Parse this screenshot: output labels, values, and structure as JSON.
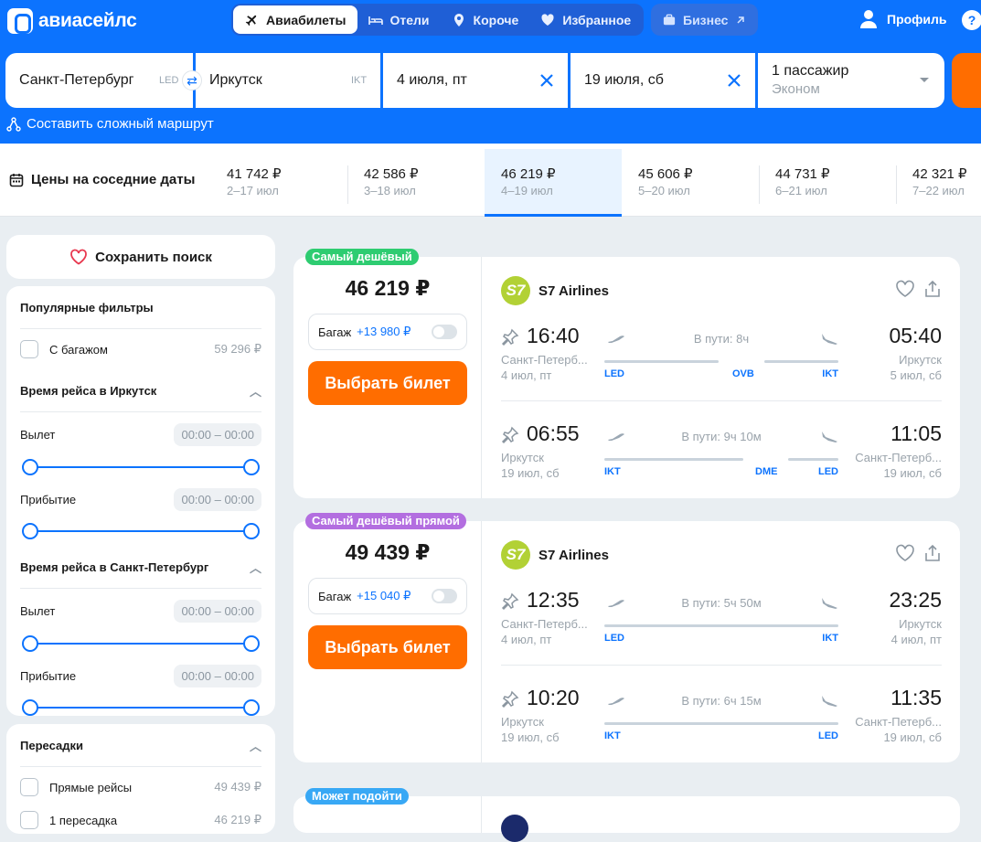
{
  "header": {
    "logo": "авиасейлс",
    "nav": [
      "Авиабилеты",
      "Отели",
      "Короче",
      "Избранное"
    ],
    "business": "Бизнес",
    "profile": "Профиль"
  },
  "search": {
    "from": "Санкт-Петербург",
    "from_code": "LED",
    "to": "Иркутск",
    "to_code": "IKT",
    "depart": "4 июля, пт",
    "return": "19 июля, сб",
    "passengers": "1 пассажир",
    "class": "Эконом",
    "complex_route": "Составить сложный маршрут"
  },
  "dates": {
    "title": "Цены на соседние даты",
    "cells": [
      {
        "price": "41 742 ₽",
        "range": "2–17 июл"
      },
      {
        "price": "42 586 ₽",
        "range": "3–18 июл"
      },
      {
        "price": "46 219 ₽",
        "range": "4–19 июл"
      },
      {
        "price": "45 606 ₽",
        "range": "5–20 июл"
      },
      {
        "price": "44 731 ₽",
        "range": "6–21 июл"
      },
      {
        "price": "42 321 ₽",
        "range": "7–22 июл"
      }
    ]
  },
  "sidebar": {
    "save": "Сохранить поиск",
    "popular": "Популярные фильтры",
    "baggage": "С багажом",
    "baggage_price": "59 296 ₽",
    "time_to": "Время рейса в Иркутск",
    "depart": "Вылет",
    "arrive": "Прибытие",
    "range": "00:00 – 00:00",
    "time_back": "Время рейса в Санкт-Петербург",
    "transfers": "Пересадки",
    "direct": "Прямые рейсы",
    "direct_price": "49 439 ₽",
    "one_transfer": "1 пересадка",
    "one_transfer_price": "46 219 ₽"
  },
  "cards": [
    {
      "tag": "Самый дешёвый",
      "tag_color": "#2ecc71",
      "price": "46 219 ₽",
      "bag": "Багаж",
      "bag_price": "+13 980 ₽",
      "buy": "Выбрать билет",
      "airline": "S7 Airlines",
      "out": {
        "dep": "16:40",
        "arr": "05:40",
        "dur": "В пути: 8ч",
        "from": "Санкт-Петерб...",
        "from_date": "4 июл, пт",
        "to": "Иркутск",
        "to_date": "5 июл, сб",
        "c1": "LED",
        "c2": "OVB",
        "c3": "IKT"
      },
      "back": {
        "dep": "06:55",
        "arr": "11:05",
        "dur": "В пути: 9ч 10м",
        "from": "Иркутск",
        "from_date": "19 июл, сб",
        "to": "Санкт-Петерб...",
        "to_date": "19 июл, сб",
        "c1": "IKT",
        "c2": "DME",
        "c3": "LED"
      }
    },
    {
      "tag": "Самый дешёвый прямой",
      "tag_color": "#b36ee0",
      "price": "49 439 ₽",
      "bag": "Багаж",
      "bag_price": "+15 040 ₽",
      "buy": "Выбрать билет",
      "airline": "S7 Airlines",
      "out": {
        "dep": "12:35",
        "arr": "23:25",
        "dur": "В пути: 5ч 50м",
        "from": "Санкт-Петерб...",
        "from_date": "4 июл, пт",
        "to": "Иркутск",
        "to_date": "4 июл, пт",
        "c1": "LED",
        "c3": "IKT"
      },
      "back": {
        "dep": "10:20",
        "arr": "11:35",
        "dur": "В пути: 6ч 15м",
        "from": "Иркутск",
        "from_date": "19 июл, сб",
        "to": "Санкт-Петерб...",
        "to_date": "19 июл, сб",
        "c1": "IKT",
        "c3": "LED"
      }
    }
  ],
  "third_tag": "Может подойти"
}
